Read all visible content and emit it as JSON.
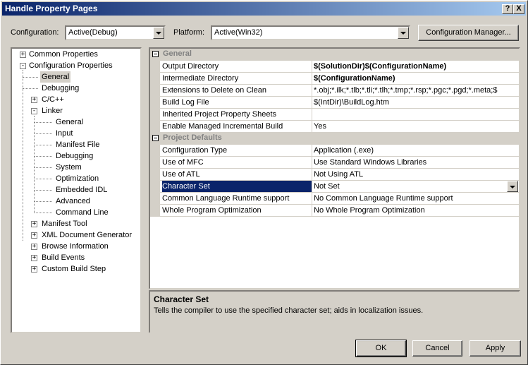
{
  "window": {
    "title": "Handle Property Pages",
    "help_glyph": "?",
    "close_glyph": "X"
  },
  "header": {
    "configuration_label": "Configuration:",
    "configuration_value": "Active(Debug)",
    "platform_label": "Platform:",
    "platform_value": "Active(Win32)",
    "config_manager_label": "Configuration Manager..."
  },
  "tree": {
    "items": [
      {
        "label": "Common Properties",
        "level": 0,
        "expander": "+"
      },
      {
        "label": "Configuration Properties",
        "level": 0,
        "expander": "-"
      },
      {
        "label": "General",
        "level": 1,
        "expander": "",
        "selected": true
      },
      {
        "label": "Debugging",
        "level": 1,
        "expander": ""
      },
      {
        "label": "C/C++",
        "level": 1,
        "expander": "+"
      },
      {
        "label": "Linker",
        "level": 1,
        "expander": "-"
      },
      {
        "label": "General",
        "level": 2,
        "expander": ""
      },
      {
        "label": "Input",
        "level": 2,
        "expander": ""
      },
      {
        "label": "Manifest File",
        "level": 2,
        "expander": ""
      },
      {
        "label": "Debugging",
        "level": 2,
        "expander": ""
      },
      {
        "label": "System",
        "level": 2,
        "expander": ""
      },
      {
        "label": "Optimization",
        "level": 2,
        "expander": ""
      },
      {
        "label": "Embedded IDL",
        "level": 2,
        "expander": ""
      },
      {
        "label": "Advanced",
        "level": 2,
        "expander": ""
      },
      {
        "label": "Command Line",
        "level": 2,
        "expander": ""
      },
      {
        "label": "Manifest Tool",
        "level": 1,
        "expander": "+"
      },
      {
        "label": "XML Document Generator",
        "level": 1,
        "expander": "+"
      },
      {
        "label": "Browse Information",
        "level": 1,
        "expander": "+"
      },
      {
        "label": "Build Events",
        "level": 1,
        "expander": "+"
      },
      {
        "label": "Custom Build Step",
        "level": 1,
        "expander": "+"
      }
    ]
  },
  "grid": {
    "categories": [
      {
        "name": "General",
        "rows": [
          {
            "name": "Output Directory",
            "value": "$(SolutionDir)$(ConfigurationName)",
            "bold": true
          },
          {
            "name": "Intermediate Directory",
            "value": "$(ConfigurationName)",
            "bold": true
          },
          {
            "name": "Extensions to Delete on Clean",
            "value": "*.obj;*.ilk;*.tlb;*.tli;*.tlh;*.tmp;*.rsp;*.pgc;*.pgd;*.meta;$"
          },
          {
            "name": "Build Log File",
            "value": "$(IntDir)\\BuildLog.htm"
          },
          {
            "name": "Inherited Project Property Sheets",
            "value": ""
          },
          {
            "name": "Enable Managed Incremental Build",
            "value": "Yes"
          }
        ]
      },
      {
        "name": "Project Defaults",
        "rows": [
          {
            "name": "Configuration Type",
            "value": "Application (.exe)"
          },
          {
            "name": "Use of MFC",
            "value": "Use Standard Windows Libraries"
          },
          {
            "name": "Use of ATL",
            "value": "Not Using ATL"
          },
          {
            "name": "Character Set",
            "value": "Not Set",
            "selected": true
          },
          {
            "name": "Common Language Runtime support",
            "value": "No Common Language Runtime support"
          },
          {
            "name": "Whole Program Optimization",
            "value": "No Whole Program Optimization"
          }
        ]
      }
    ]
  },
  "description": {
    "title": "Character Set",
    "text": "Tells the compiler to use the specified character set; aids in localization issues."
  },
  "buttons": {
    "ok": "OK",
    "cancel": "Cancel",
    "apply": "Apply"
  }
}
